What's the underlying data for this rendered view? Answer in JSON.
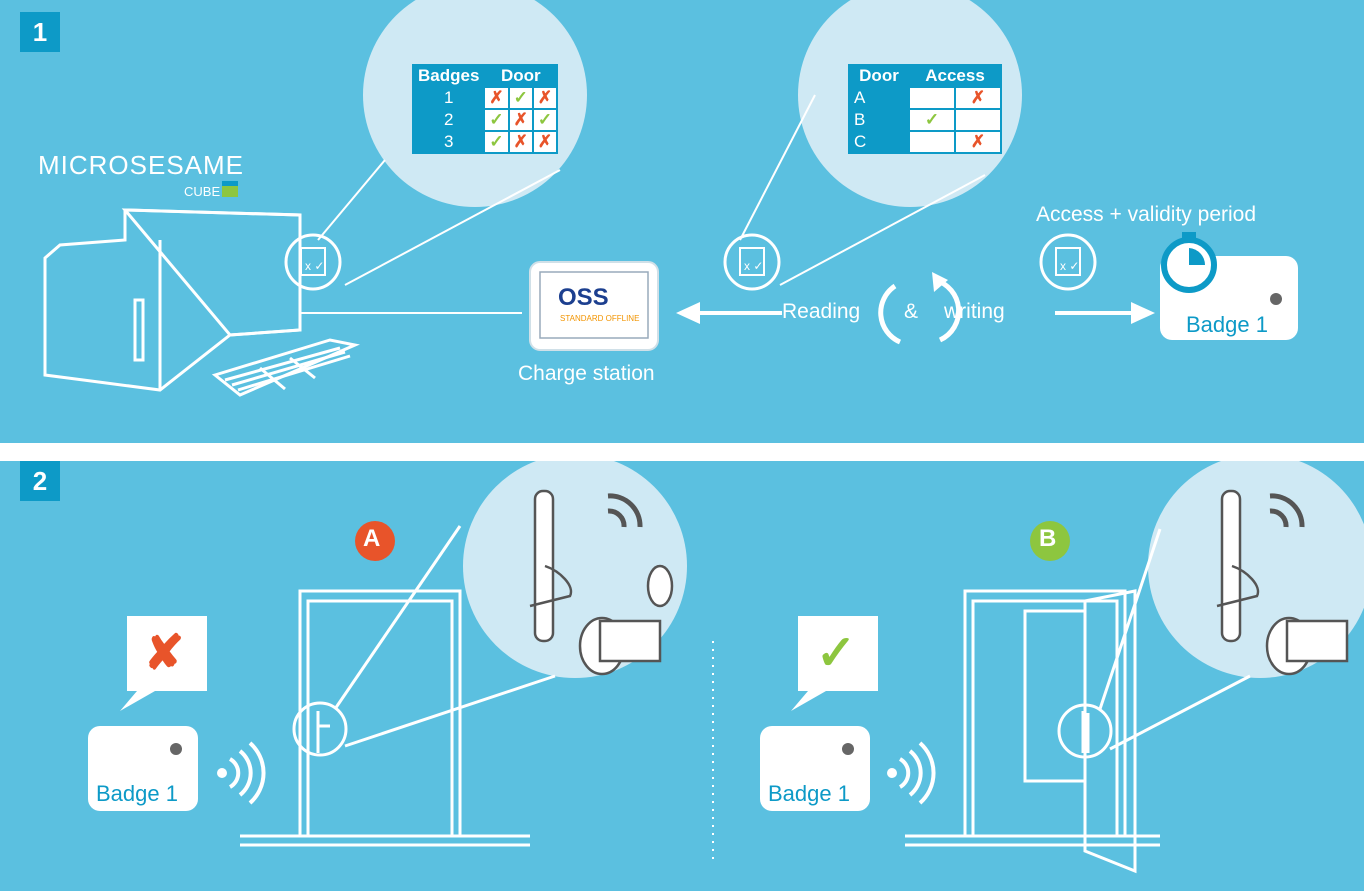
{
  "panel1": {
    "step": "1",
    "logo_main": "MICROSESAME",
    "logo_sub": "CUBE",
    "charge_station_label": "Charge station",
    "oss_text": "OSS",
    "oss_sub": "STANDARD OFFLINE",
    "reading_label": "Reading",
    "amp_label": "&",
    "writing_label": "writing",
    "access_validity_label": "Access + validity period",
    "badge_label": "Badge 1",
    "badges_table": {
      "headers": [
        "Badges",
        "Door"
      ],
      "rows": [
        {
          "id": "1",
          "cells": [
            "✗",
            "✓",
            "✗"
          ]
        },
        {
          "id": "2",
          "cells": [
            "✓",
            "✗",
            "✓"
          ]
        },
        {
          "id": "3",
          "cells": [
            "✓",
            "✗",
            "✗"
          ]
        }
      ]
    },
    "door_table": {
      "headers": [
        "Door",
        "Access"
      ],
      "rows": [
        {
          "id": "A",
          "cells": [
            "",
            "✗"
          ]
        },
        {
          "id": "B",
          "cells": [
            "✓",
            ""
          ]
        },
        {
          "id": "C",
          "cells": [
            "",
            "✗"
          ]
        }
      ]
    }
  },
  "panel2": {
    "step": "2",
    "door_a_label": "A",
    "door_b_label": "B",
    "badge_left_label": "Badge 1",
    "badge_right_label": "Badge 1",
    "deny_mark": "✘",
    "allow_mark": "✓"
  },
  "colors": {
    "background": "#5bc0e0",
    "accent_dark": "#0d9ac7",
    "circle": "#cfe9f4",
    "red": "#e8542a",
    "green": "#8dc63f"
  }
}
